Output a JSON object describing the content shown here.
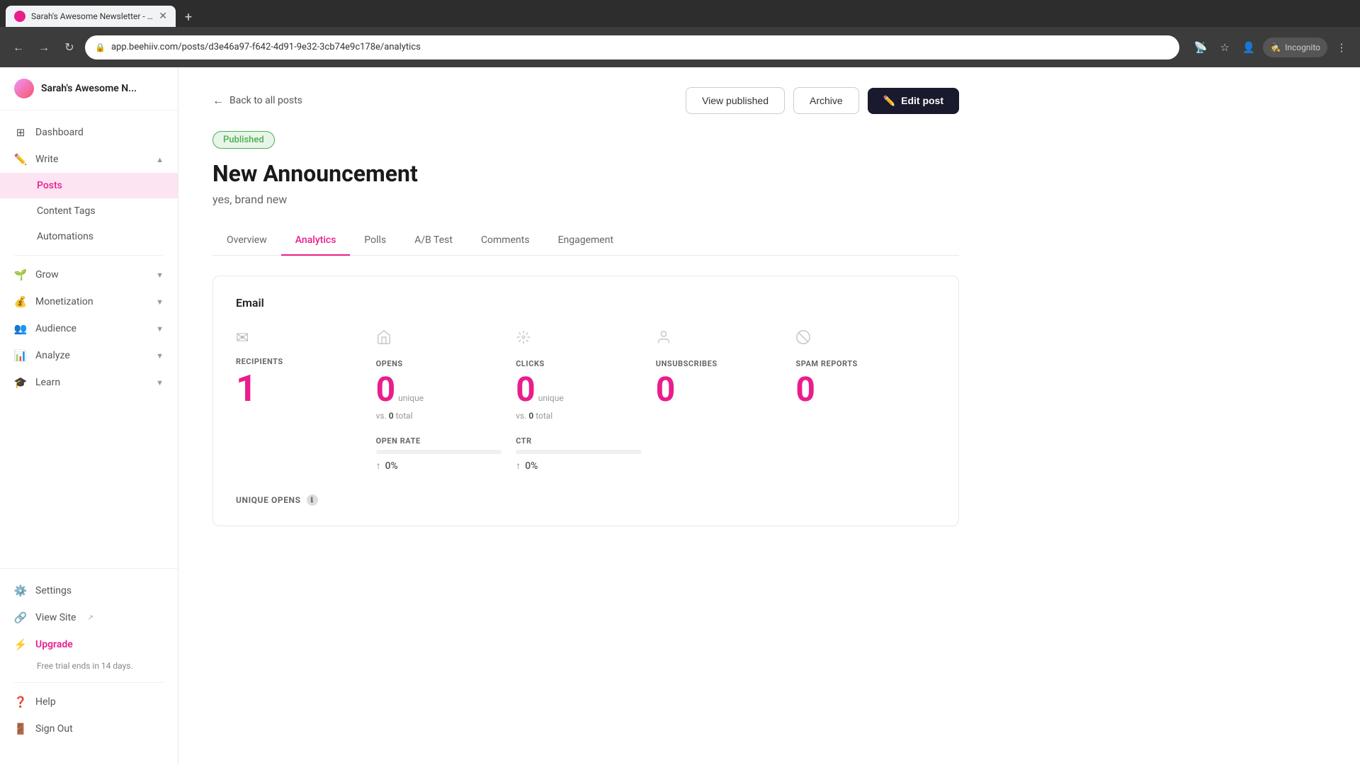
{
  "browser": {
    "tab_title": "Sarah's Awesome Newsletter - b...",
    "favicon_color": "#e91e8c",
    "url": "app.beehiiv.com/posts/d3e46a97-f642-4d91-9e32-3cb74e9c178e/analytics",
    "incognito_label": "Incognito"
  },
  "sidebar": {
    "brand_name": "Sarah's Awesome N...",
    "nav_items": [
      {
        "id": "dashboard",
        "label": "Dashboard",
        "icon": "⊞",
        "has_chevron": false
      },
      {
        "id": "write",
        "label": "Write",
        "icon": "✏️",
        "has_chevron": true
      },
      {
        "id": "posts",
        "label": "Posts",
        "icon": "",
        "sub": true,
        "active": true
      },
      {
        "id": "content-tags",
        "label": "Content Tags",
        "icon": "",
        "sub": true
      },
      {
        "id": "automations",
        "label": "Automations",
        "icon": "",
        "sub": true
      },
      {
        "id": "grow",
        "label": "Grow",
        "icon": "🌱",
        "has_chevron": true
      },
      {
        "id": "monetization",
        "label": "Monetization",
        "icon": "💰",
        "has_chevron": true
      },
      {
        "id": "audience",
        "label": "Audience",
        "icon": "👥",
        "has_chevron": true
      },
      {
        "id": "analyze",
        "label": "Analyze",
        "icon": "📊",
        "has_chevron": true
      },
      {
        "id": "learn",
        "label": "Learn",
        "icon": "🎓",
        "has_chevron": true
      }
    ],
    "bottom_items": [
      {
        "id": "settings",
        "label": "Settings",
        "icon": "⚙️"
      },
      {
        "id": "view-site",
        "label": "View Site",
        "icon": "🔗",
        "external": true
      },
      {
        "id": "upgrade",
        "label": "Upgrade",
        "icon": "⚡",
        "accent": true
      }
    ],
    "trial_text": "Free trial ends in 14 days.",
    "help_label": "Help",
    "sign_out_label": "Sign Out"
  },
  "header": {
    "back_label": "Back to all posts",
    "view_published_label": "View published",
    "archive_label": "Archive",
    "edit_post_label": "Edit post"
  },
  "post": {
    "status": "Published",
    "title": "New Announcement",
    "subtitle": "yes, brand new"
  },
  "tabs": [
    {
      "id": "overview",
      "label": "Overview"
    },
    {
      "id": "analytics",
      "label": "Analytics",
      "active": true
    },
    {
      "id": "polls",
      "label": "Polls"
    },
    {
      "id": "ab-test",
      "label": "A/B Test"
    },
    {
      "id": "comments",
      "label": "Comments"
    },
    {
      "id": "engagement",
      "label": "Engagement"
    }
  ],
  "analytics": {
    "section_label": "Email",
    "metrics": [
      {
        "id": "recipients",
        "icon": "✉",
        "label": "RECIPIENTS",
        "value": "1",
        "subtext": null,
        "rate": null
      },
      {
        "id": "opens",
        "icon": "📬",
        "label": "OPENS",
        "value": "0",
        "unique_label": "unique",
        "vs_label": "vs.",
        "vs_value": "0",
        "vs_suffix": "total",
        "rate_label": "OPEN RATE",
        "rate_value": "0%",
        "rate_fill": 0
      },
      {
        "id": "clicks",
        "icon": "✨",
        "label": "CLICKS",
        "value": "0",
        "unique_label": "unique",
        "vs_label": "vs.",
        "vs_value": "0",
        "vs_suffix": "total",
        "rate_label": "CTR",
        "rate_value": "0%",
        "rate_fill": 0
      },
      {
        "id": "unsubscribes",
        "icon": "👤",
        "label": "UNSUBSCRIBES",
        "value": "0",
        "subtext": null,
        "rate": null
      },
      {
        "id": "spam-reports",
        "icon": "🚫",
        "label": "SPAM REPORTS",
        "value": "0",
        "subtext": null,
        "rate": null
      }
    ],
    "unique_opens_label": "UNIQUE OPENS"
  },
  "accent_color": "#e91e8c"
}
